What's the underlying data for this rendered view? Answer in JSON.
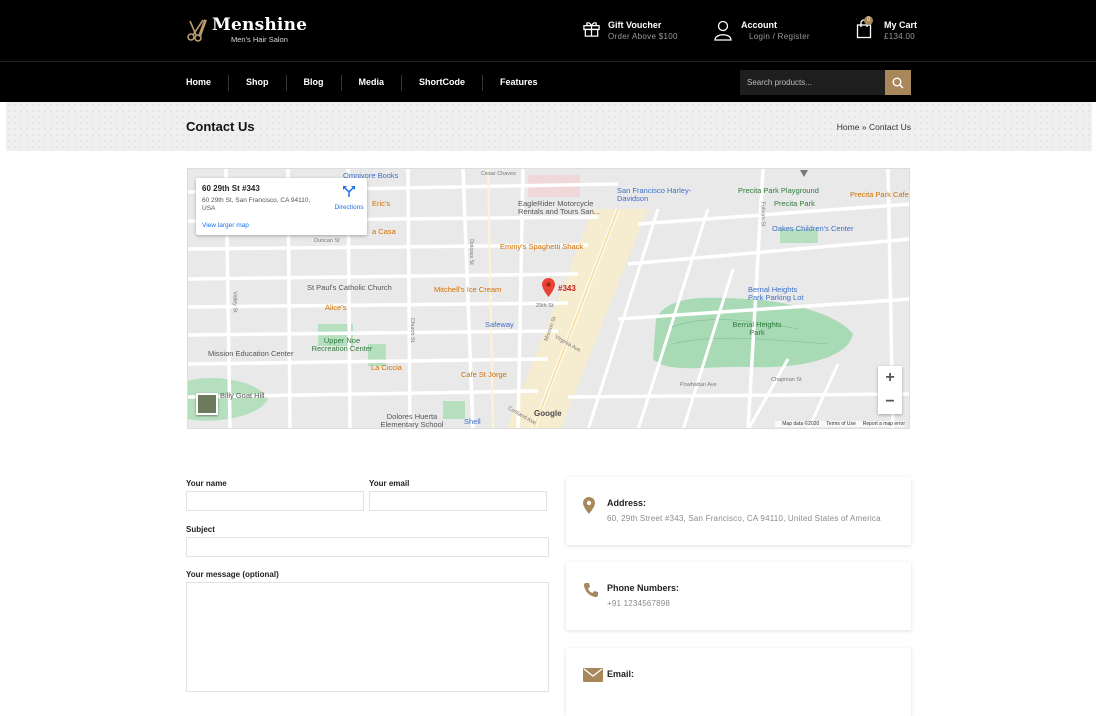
{
  "brand": {
    "name": "Menshine",
    "tagline": "Men's Hair Salon"
  },
  "header": {
    "voucher": {
      "title": "Gift Voucher",
      "subtitle": "Order Above $100",
      "icon": "gift-icon"
    },
    "account": {
      "title": "Account",
      "subtitle": "Login / Register",
      "icon": "user-icon"
    },
    "cart": {
      "title": "My Cart",
      "subtitle": "£134.00",
      "count": "0",
      "icon": "shopping-bag-icon"
    }
  },
  "nav": {
    "items": [
      {
        "label": "Home"
      },
      {
        "label": "Shop"
      },
      {
        "label": "Blog"
      },
      {
        "label": "Media"
      },
      {
        "label": "ShortCode"
      },
      {
        "label": "Features"
      }
    ],
    "search_placeholder": "Search products...",
    "search_icon": "search-icon"
  },
  "page": {
    "title": "Contact Us",
    "breadcrumb": {
      "home": "Home",
      "separator": "»",
      "current": "Contact Us"
    }
  },
  "map": {
    "card": {
      "title": "60 29th St #343",
      "address": "60 29th St, San Francisco, CA 94110, USA",
      "directions": "Directions",
      "larger_map": "View larger map"
    },
    "pin_label": "#343",
    "labels": [
      {
        "text": "Omnivore Books",
        "kind": "poi-blue"
      },
      {
        "text": "Eric's",
        "kind": "poi-orange"
      },
      {
        "text": "a Casa",
        "kind": "poi-orange"
      },
      {
        "text": "Cesar Chavez",
        "kind": "street"
      },
      {
        "text": "San Francisco Harley-Davidson",
        "kind": "poi-blue"
      },
      {
        "text": "EagleRider Motorcycle Rentals and Tours San...",
        "kind": ""
      },
      {
        "text": "Precita Park Playground",
        "kind": "poi-green"
      },
      {
        "text": "Precita Park Cafe",
        "kind": "poi-orange"
      },
      {
        "text": "Precita Park",
        "kind": "poi-green"
      },
      {
        "text": "Emmy's Spaghetti Shack",
        "kind": "poi-orange"
      },
      {
        "text": "Oakes Children's Center",
        "kind": "poi-blue"
      },
      {
        "text": "St Paul's Catholic Church",
        "kind": ""
      },
      {
        "text": "Mitchell's Ice Cream",
        "kind": "poi-orange"
      },
      {
        "text": "29th St",
        "kind": "street"
      },
      {
        "text": "Alice's",
        "kind": "poi-orange"
      },
      {
        "text": "Safeway",
        "kind": "poi-blue"
      },
      {
        "text": "Bernal Heights Park Parking Lot",
        "kind": "poi-blue"
      },
      {
        "text": "Bernal Heights Park",
        "kind": "poi-green"
      },
      {
        "text": "Upper Noe Recreation Center",
        "kind": "poi-green"
      },
      {
        "text": "Mission Education Center",
        "kind": ""
      },
      {
        "text": "La Ciccia",
        "kind": "poi-orange"
      },
      {
        "text": "Cafe St Jorge",
        "kind": "poi-orange"
      },
      {
        "text": "Billy Goat Hill",
        "kind": ""
      },
      {
        "text": "Dolores Huerta Elementary School",
        "kind": ""
      },
      {
        "text": "Shell",
        "kind": "poi-blue"
      },
      {
        "text": "Dolores St",
        "kind": "street"
      },
      {
        "text": "Mission St",
        "kind": "street"
      },
      {
        "text": "Folsom St",
        "kind": "street"
      },
      {
        "text": "Duncan St",
        "kind": "street"
      },
      {
        "text": "Valley St",
        "kind": "street"
      },
      {
        "text": "Church St",
        "kind": "street"
      },
      {
        "text": "Virginia Ave",
        "kind": "street"
      },
      {
        "text": "Powhattan Ave",
        "kind": "street"
      },
      {
        "text": "Chapman St",
        "kind": "street"
      },
      {
        "text": "Cortland Ave",
        "kind": "street"
      }
    ],
    "zoom_in": "+",
    "zoom_out": "−",
    "google": "Google",
    "footer": {
      "data": "Map data ©2020",
      "terms": "Terms of Use",
      "report": "Report a map error"
    }
  },
  "form": {
    "name_label": "Your name",
    "email_label": "Your email",
    "subject_label": "Subject",
    "message_label": "Your message (optional)"
  },
  "contact": {
    "address": {
      "title": "Address:",
      "text": "60, 29th Street #343, San Francisco, CA 94110, United States of America",
      "icon": "map-pin-icon"
    },
    "phone": {
      "title": "Phone Numbers:",
      "text": "+91 1234567898",
      "icon": "phone-icon"
    },
    "email": {
      "title": "Email:",
      "text": "",
      "icon": "envelope-icon"
    }
  },
  "colors": {
    "accent": "#a8875a",
    "header_bg": "#000000",
    "pin": "#ea4335"
  }
}
